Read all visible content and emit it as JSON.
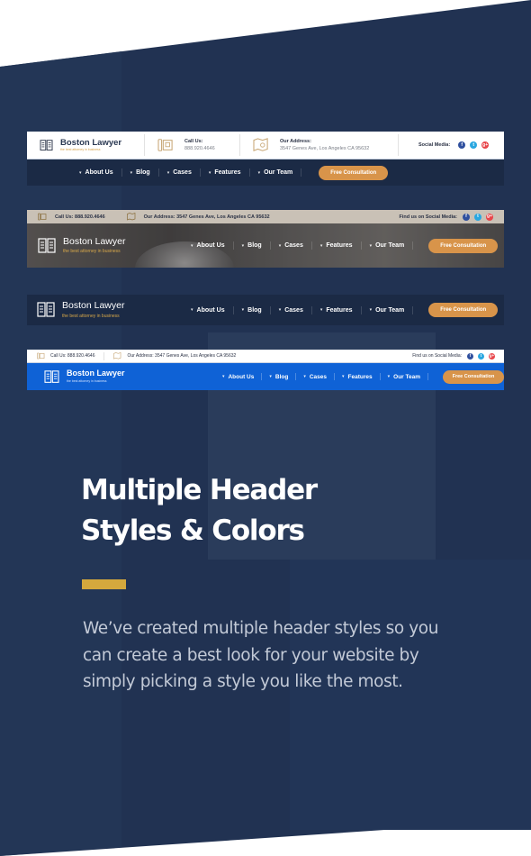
{
  "colors": {
    "background": "#213252",
    "dark_header": "#1b2a45",
    "blue_header": "#0f62d6",
    "cta": "#d8944a",
    "accent": "#d4a83d",
    "tagline_gold": "#d59f45"
  },
  "brand": {
    "name": "Boston Lawyer",
    "tagline": "the best attorney in business",
    "logo_icon": "open-book-icon"
  },
  "nav": {
    "items": [
      {
        "label": "About Us",
        "icon": "chevron-down-icon"
      },
      {
        "label": "Blog",
        "icon": "chevron-down-icon"
      },
      {
        "label": "Cases",
        "icon": "chevron-down-icon"
      },
      {
        "label": "Features",
        "icon": "chevron-down-icon"
      },
      {
        "label": "Our Team",
        "icon": "chevron-down-icon"
      }
    ],
    "cta_label": "Free Consultation",
    "chevron": "▾"
  },
  "social": {
    "icons": [
      {
        "name": "facebook-icon",
        "glyph": "f"
      },
      {
        "name": "twitter-icon",
        "glyph": "t"
      },
      {
        "name": "google-plus-icon",
        "glyph": "g+"
      }
    ]
  },
  "header1": {
    "call_label": "Call Us:",
    "call_value": "888.920.4646",
    "call_icon": "phone-icon",
    "address_label": "Our Address:",
    "address_value": "3547 Genes Ave, Los Angeles CA 95632",
    "address_icon": "map-pin-icon",
    "social_label": "Social Media:"
  },
  "header2": {
    "call_text": "Call Us: 888.920.4646",
    "address_text": "Our Address: 3547 Genes Ave, Los Angeles CA 95632",
    "social_label": "Find us on Social Media:"
  },
  "header4": {
    "call_text": "Call Us: 888.920.4646",
    "address_text": "Our Address: 3547 Genes Ave, Los Angeles CA 95632",
    "social_label": "Find us on Social Media:"
  },
  "feature": {
    "title_line1": "Multiple Header",
    "title_line2": "Styles & Colors",
    "description": "We’ve created multiple header styles so you can create a best look for your website by simply picking a style you like the most."
  }
}
